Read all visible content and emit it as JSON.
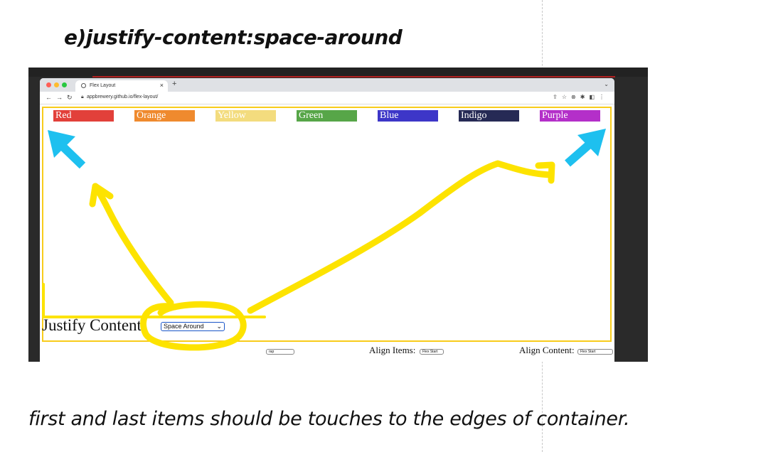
{
  "heading": "e)justify-content:space-around",
  "caption": "first and last items should be touches to the edges of container.",
  "browser": {
    "tab_title": "Flex Layout",
    "tab_close": "×",
    "new_tab": "+",
    "url": "appbrewery.github.io/flex-layout/"
  },
  "flex_items": [
    {
      "label": "Red",
      "color": "#e2403a"
    },
    {
      "label": "Orange",
      "color": "#ef8a2e"
    },
    {
      "label": "Yellow",
      "color": "#f3dc7e"
    },
    {
      "label": "Green",
      "color": "#57a648"
    },
    {
      "label": "Blue",
      "color": "#3d36c8"
    },
    {
      "label": "Indigo",
      "color": "#262a55"
    },
    {
      "label": "Purple",
      "color": "#b42fc9"
    }
  ],
  "controls": {
    "justify_label": "Justify Content:",
    "justify_value": "Space Around",
    "wrap_value": "rap",
    "align_items_label": "Align Items:",
    "align_items_value": "Flex Start",
    "align_content_label": "Align Content:",
    "align_content_value": "Flex Start"
  },
  "colors": {
    "annotation_yellow": "#fde300",
    "annotation_blue": "#1ec0ef",
    "container_border": "#f8cc1b"
  }
}
